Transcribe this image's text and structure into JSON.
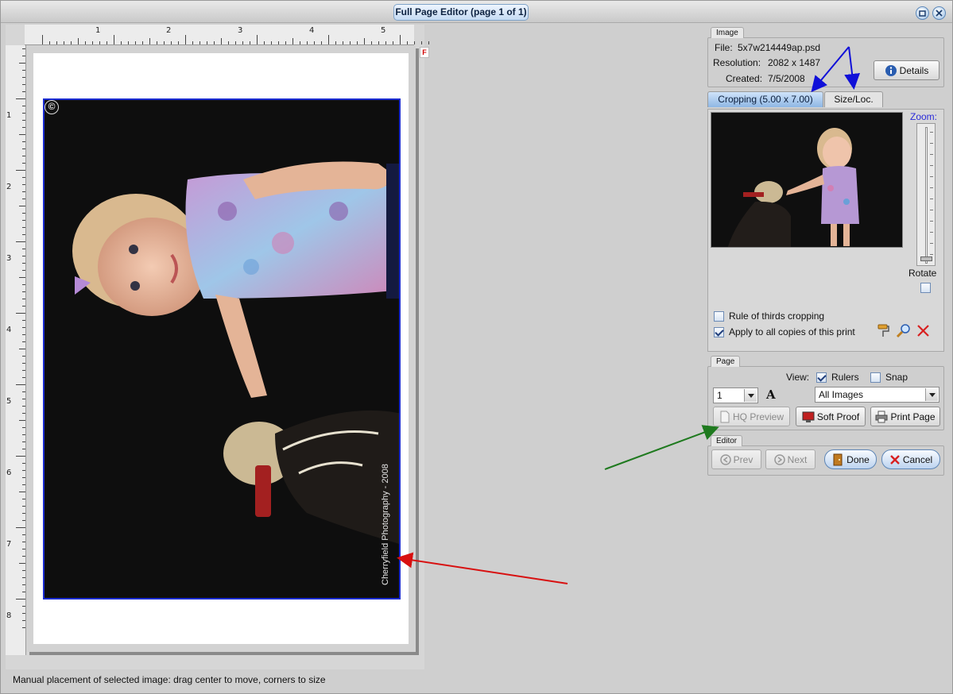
{
  "window": {
    "title": "Full Page Editor (page 1 of 1)"
  },
  "rulers": {
    "horizontal": [
      "1",
      "2",
      "3",
      "4",
      "5"
    ],
    "vertical": [
      "1",
      "2",
      "3",
      "4",
      "5",
      "6",
      "7",
      "8"
    ],
    "corner_marker": "F"
  },
  "canvas": {
    "watermark": "Cherryfield Photography  - 2008",
    "copyright_symbol": "©"
  },
  "image_group": {
    "tab": "Image",
    "file_label": "File:",
    "file_value": "5x7w214449ap.psd",
    "resolution_label": "Resolution:",
    "resolution_value": "2082 x 1487",
    "created_label": "Created:",
    "created_value": "7/5/2008",
    "details_button": "Details"
  },
  "crop_tabs": {
    "cropping": "Cropping (5.00 x 7.00)",
    "size_loc": "Size/Loc."
  },
  "crop_panel": {
    "zoom_label": "Zoom:",
    "rotate_label": "Rotate",
    "rule_of_thirds": "Rule of thirds cropping",
    "apply_all": "Apply to all copies of this print",
    "rule_of_thirds_checked": false,
    "apply_all_checked": true
  },
  "page_group": {
    "tab": "Page",
    "view_label": "View:",
    "rulers_label": "Rulers",
    "snap_label": "Snap",
    "rulers_checked": true,
    "snap_checked": false,
    "page_number": "1",
    "image_filter": "All Images",
    "hq_preview": "HQ Preview",
    "soft_proof": "Soft Proof",
    "print_page": "Print Page"
  },
  "editor_group": {
    "tab": "Editor",
    "prev": "Prev",
    "next": "Next",
    "done": "Done",
    "cancel": "Cancel"
  },
  "status_bar": {
    "message": "Manual placement of selected image: drag center to move, corners to size"
  },
  "colors": {
    "annotation_blue": "#1010d8",
    "annotation_green": "#1f7a1f",
    "annotation_red": "#d81010",
    "crop_border": "#1a2bd0"
  }
}
